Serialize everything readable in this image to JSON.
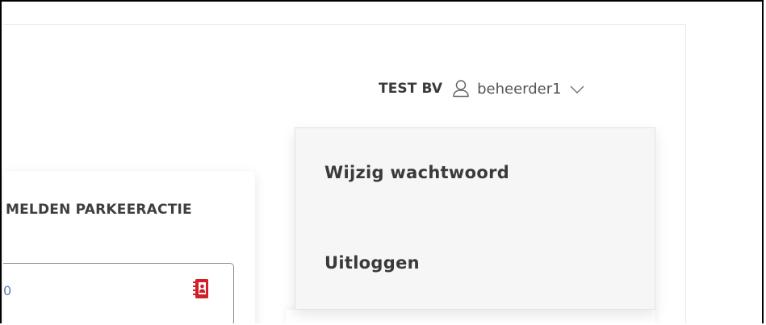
{
  "header": {
    "company": "TEST BV",
    "user_icon": "user-icon",
    "username": "beheerder1",
    "chevron_icon": "chevron-down-icon"
  },
  "card": {
    "title": "MELDEN PARKEERACTIE",
    "field_value": "0",
    "contact_icon": "address-book-icon",
    "accent_color": "#d0202a"
  },
  "user_menu": {
    "items": [
      {
        "label": "Wijzig wachtwoord"
      },
      {
        "label": "Uitloggen"
      }
    ]
  }
}
